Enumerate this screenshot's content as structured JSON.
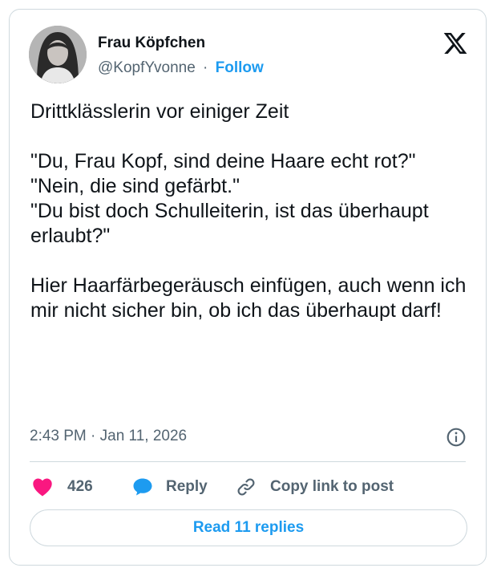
{
  "author": {
    "name": "Frau Köpfchen",
    "handle": "@KopfYvonne",
    "separator": "·",
    "follow_label": "Follow"
  },
  "tweet": {
    "text": "Drittklässlerin vor einiger Zeit\n\n\"Du, Frau Kopf, sind deine Haare echt rot?\"\n\"Nein, die sind gefärbt.\"\n\"Du bist doch Schulleiterin, ist das überhaupt erlaubt?\"\n\nHier Haarfärbegeräusch einfügen, auch wenn ich mir nicht sicher bin, ob ich das überhaupt darf!",
    "timestamp": "2:43 PM · Jan 11, 2026"
  },
  "actions": {
    "like_count": "426",
    "reply_label": "Reply",
    "copy_label": "Copy link to post"
  },
  "read_replies_label": "Read 11 replies",
  "icons": {
    "logo": "x-logo-icon",
    "info": "info-icon",
    "like": "heart-icon",
    "reply": "speech-bubble-icon",
    "copy": "link-icon"
  },
  "colors": {
    "accent": "#1d9bf0",
    "heart": "#f91880",
    "text": "#0f1419",
    "muted": "#536471",
    "border": "#cfd9de"
  }
}
